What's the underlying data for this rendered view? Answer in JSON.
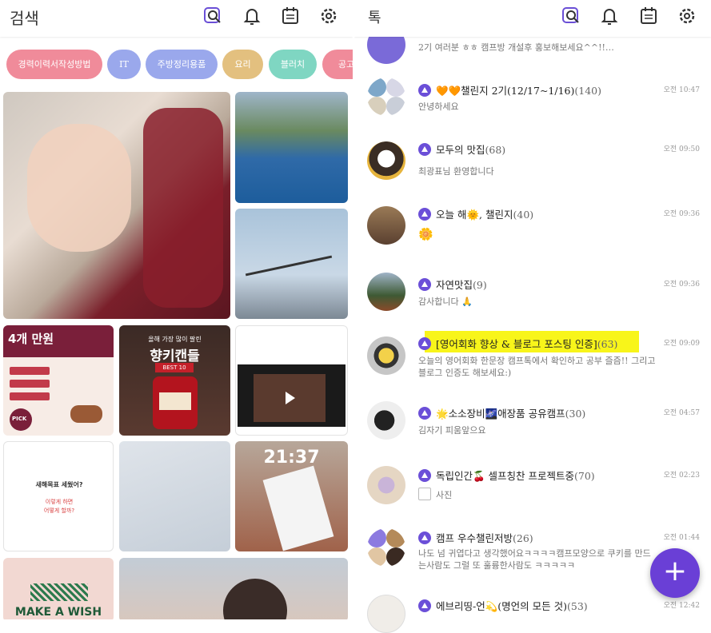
{
  "left": {
    "title": "검색",
    "chips": [
      {
        "label": "경력이력서작성방법",
        "color": "#f08b9a"
      },
      {
        "label": "IT",
        "color": "#9aa8ec"
      },
      {
        "label": "주방정리용품",
        "color": "#9aa8ec"
      },
      {
        "label": "요리",
        "color": "#e3c07f"
      },
      {
        "label": "블러치",
        "color": "#7fd6c2"
      },
      {
        "label": "공고",
        "color": "#f08b9a"
      }
    ],
    "tiles": {
      "promo_title": "4개 만원",
      "promo_badge": "PICK",
      "candle_title": "향키캔들",
      "candle_sub": "BEST 10",
      "candle_header": "올해 가장 많이 팔린",
      "note_line1": "새해목표 세웠어?",
      "note_line2": "이렇게 하면",
      "note_line3": "어떻게 할까?",
      "clock": "21:37",
      "wish": "MAKE A WISH"
    }
  },
  "right": {
    "title": "톡",
    "chats": [
      {
        "name": "",
        "count": "",
        "msg": "2기 여러분 ㅎㅎ 캠프방 개설후 홍보해보세요^^!!…",
        "time": ""
      },
      {
        "name": "🧡🧡챌린지 2기(12/17~1/16)",
        "count": "(140)",
        "msg": "안녕하세요",
        "time": "오전 10:47"
      },
      {
        "name": "모두의 맛집",
        "count": "(68)",
        "msg": "최광표님 환영합니다",
        "time": "오전 09:50"
      },
      {
        "name": "오늘 해🌞, 챌린지",
        "count": "(40)",
        "msg": "🌼",
        "time": "오전 09:36"
      },
      {
        "name": "자연맛집",
        "count": "(9)",
        "msg": "감사합니다 🙏",
        "time": "오전 09:36"
      },
      {
        "name": "[영어회화 향상 & 블로그 포스팅 인증]",
        "count": "(63)",
        "msg": "오늘의 영어회화 한문장 캠프톡에서 확인하고 공부 즐즘!! 그리고 블로그 인증도 해보세요:)",
        "time": "오전 09:09"
      },
      {
        "name": "🌟소소장비🌌애장품 공유캠프",
        "count": "(30)",
        "msg": "김자기 피움앞으요",
        "time": "오전 04:57"
      },
      {
        "name": "독립인간🍒 셀프칭찬 프로젝트중",
        "count": "(70)",
        "msg": "사진",
        "time": "오전 02:23"
      },
      {
        "name": "캠프 우수챌린저방",
        "count": "(26)",
        "msg": "나도 넘 귀엽다고 생각했어요ㅋㅋㅋㅋ캠프모양으로 쿠키를 만드는사람도 그럴 또 훌륭한사람도 ㅋㅋㅋㅋㅋ",
        "time": "오전 01:44"
      },
      {
        "name": "에브리띵-언💫(명언의 모든 것)",
        "count": "(53)",
        "msg": "",
        "time": "오전 12:42"
      }
    ],
    "fab_label": "+"
  }
}
